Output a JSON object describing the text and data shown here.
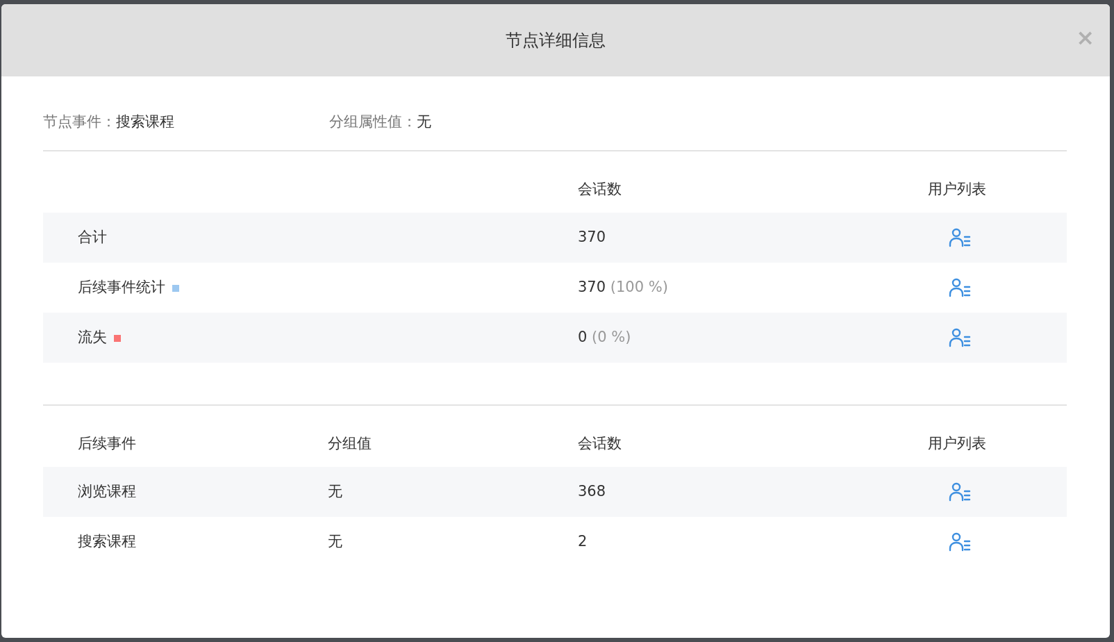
{
  "dialog": {
    "title": "节点详细信息",
    "close": "×"
  },
  "info": [
    {
      "label": "节点事件：",
      "value": "搜索课程"
    },
    {
      "label": "分组属性值：",
      "value": "无"
    }
  ],
  "summary_table": {
    "columns": [
      "会话数",
      "用户列表"
    ],
    "rows": [
      {
        "name": "合计",
        "sessions": "370"
      },
      {
        "name": "后续事件统计",
        "color": "#9dc8f0",
        "sessions": "370",
        "percent": "(100 %)"
      },
      {
        "name": "流失",
        "color": "#fa7474",
        "sessions": "0",
        "percent": "(0 %)"
      }
    ]
  },
  "next_events_table": {
    "columns": [
      "后续事件",
      "分组值",
      "会话数",
      "用户列表"
    ],
    "rows": [
      {
        "event": "浏览课程",
        "group": "无",
        "sessions": "368"
      },
      {
        "event": "搜索课程",
        "group": "无",
        "sessions": "2"
      }
    ]
  }
}
